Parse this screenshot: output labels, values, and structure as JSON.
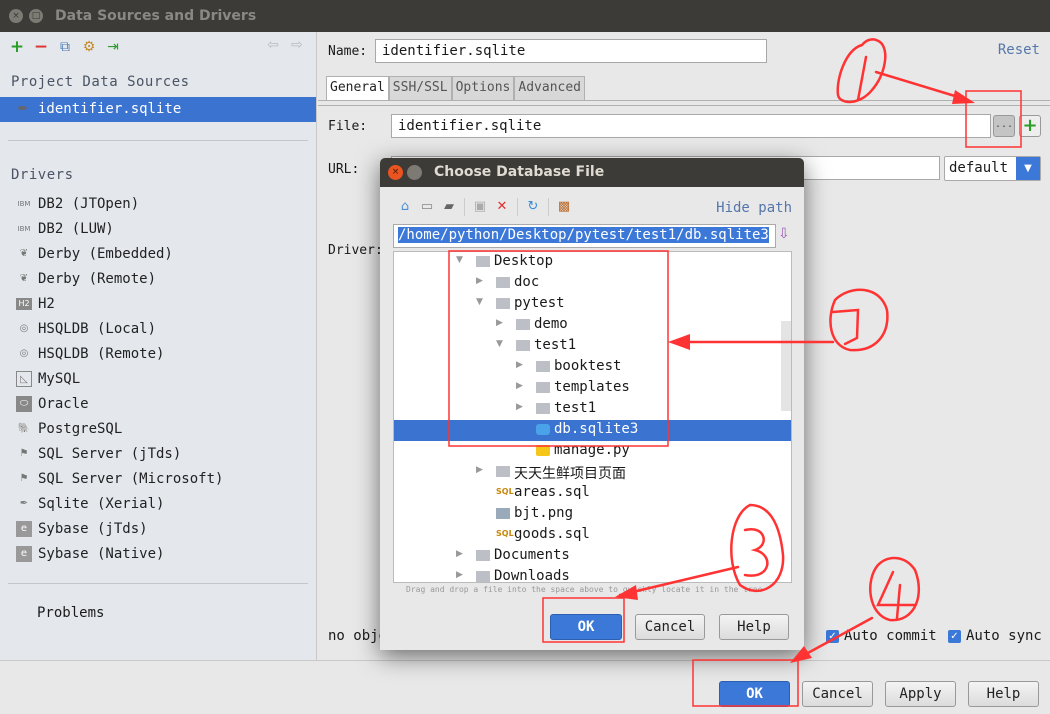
{
  "window": {
    "title": "Data Sources and Drivers"
  },
  "sidebar": {
    "toolbar": [
      {
        "name": "add-icon",
        "glyph": "+"
      },
      {
        "name": "remove-icon",
        "glyph": "−"
      },
      {
        "name": "copy-icon",
        "glyph": "⧉"
      },
      {
        "name": "wrench-icon",
        "glyph": "⚙"
      },
      {
        "name": "import-icon",
        "glyph": "⇥"
      }
    ],
    "nav_back": "⇦",
    "nav_forward": "⇨",
    "project_heading": "Project Data Sources",
    "selected_source": "identifier.sqlite",
    "drivers_heading": "Drivers",
    "drivers": [
      {
        "label": "DB2 (JTOpen)",
        "icon": "IBM"
      },
      {
        "label": "DB2 (LUW)",
        "icon": "IBM"
      },
      {
        "label": "Derby (Embedded)",
        "icon": "❦"
      },
      {
        "label": "Derby (Remote)",
        "icon": "❦"
      },
      {
        "label": "H2",
        "icon": "H2"
      },
      {
        "label": "HSQLDB (Local)",
        "icon": "◎"
      },
      {
        "label": "HSQLDB (Remote)",
        "icon": "◎"
      },
      {
        "label": "MySQL",
        "icon": "◺"
      },
      {
        "label": "Oracle",
        "icon": "⬭"
      },
      {
        "label": "PostgreSQL",
        "icon": "🐘"
      },
      {
        "label": "SQL Server (jTds)",
        "icon": "⚑"
      },
      {
        "label": "SQL Server (Microsoft)",
        "icon": "⚑"
      },
      {
        "label": "Sqlite (Xerial)",
        "icon": "✒"
      },
      {
        "label": "Sybase (jTds)",
        "icon": "e"
      },
      {
        "label": "Sybase (Native)",
        "icon": "e"
      }
    ],
    "problems": "Problems"
  },
  "main": {
    "name_label": "Name:",
    "name_value": "identifier.sqlite",
    "reset": "Reset",
    "tabs": [
      "General",
      "SSH/SSL",
      "Options",
      "Advanced"
    ],
    "active_tab": "General",
    "file_label": "File:",
    "file_value": "identifier.sqlite",
    "browse_button": "...",
    "add_button": "+",
    "url_label": "URL:",
    "url_mode": "default",
    "driver_label": "Driver:",
    "no_objects_text": "no obje",
    "auto_commit": "Auto commit",
    "auto_sync": "Auto sync",
    "auto_commit_checked": true,
    "auto_sync_checked": true
  },
  "footer": {
    "ok": "OK",
    "cancel": "Cancel",
    "apply": "Apply",
    "help": "Help"
  },
  "dialog": {
    "title": "Choose Database File",
    "hide_path": "Hide path",
    "path": "/home/python/Desktop/pytest/test1/db.sqlite3",
    "tree": [
      {
        "label": "Desktop",
        "depth": 0,
        "expand": "open",
        "type": "folder"
      },
      {
        "label": "doc",
        "depth": 1,
        "expand": "closed",
        "type": "folder"
      },
      {
        "label": "pytest",
        "depth": 1,
        "expand": "open",
        "type": "folder"
      },
      {
        "label": "demo",
        "depth": 2,
        "expand": "closed",
        "type": "folder"
      },
      {
        "label": "test1",
        "depth": 2,
        "expand": "open",
        "type": "folder"
      },
      {
        "label": "booktest",
        "depth": 3,
        "expand": "closed",
        "type": "folder"
      },
      {
        "label": "templates",
        "depth": 3,
        "expand": "closed",
        "type": "folder"
      },
      {
        "label": "test1",
        "depth": 3,
        "expand": "closed",
        "type": "folder"
      },
      {
        "label": "db.sqlite3",
        "depth": 3,
        "expand": "none",
        "type": "db",
        "selected": true
      },
      {
        "label": "manage.py",
        "depth": 3,
        "expand": "none",
        "type": "py"
      },
      {
        "label": "天天生鲜项目页面",
        "depth": 1,
        "expand": "closed",
        "type": "folder"
      },
      {
        "label": "areas.sql",
        "depth": 1,
        "expand": "none",
        "type": "sql"
      },
      {
        "label": "bjt.png",
        "depth": 1,
        "expand": "none",
        "type": "img"
      },
      {
        "label": "goods.sql",
        "depth": 1,
        "expand": "none",
        "type": "sql"
      },
      {
        "label": "Documents",
        "depth": 0,
        "expand": "closed",
        "type": "folder"
      },
      {
        "label": "Downloads",
        "depth": 0,
        "expand": "closed",
        "type": "folder"
      }
    ],
    "dnd_hint": "Drag and drop a file into the space above to quickly locate it in the tree",
    "ok": "OK",
    "cancel": "Cancel",
    "help": "Help"
  },
  "annotations": {
    "color": "#ff3333",
    "labels": [
      "1",
      "2",
      "3",
      "4"
    ]
  }
}
